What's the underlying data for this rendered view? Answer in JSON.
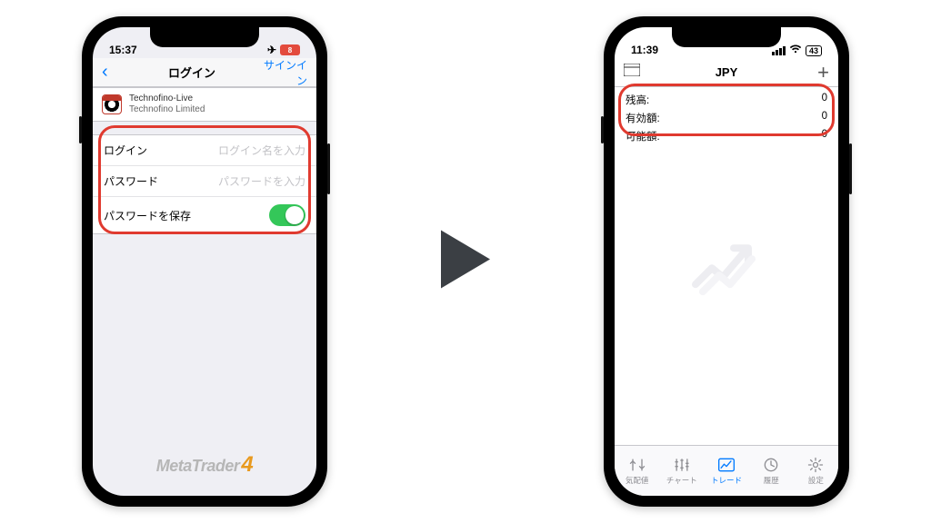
{
  "left": {
    "status_time": "15:37",
    "status_battery_low_badge": "8",
    "nav_title": "ログイン",
    "nav_signin": "サインイン",
    "account": {
      "name": "Technofino-Live",
      "company": "Technofino Limited"
    },
    "form": {
      "login_label": "ログイン",
      "login_placeholder": "ログイン名を入力",
      "password_label": "パスワード",
      "password_placeholder": "パスワードを入力",
      "save_password_label": "パスワードを保存",
      "save_password_on": true
    },
    "logo_text": "MetaTrader",
    "logo_num": "4"
  },
  "right": {
    "status_time": "11:39",
    "status_battery_pct": "43",
    "nav_title": "JPY",
    "summary": {
      "balance_label": "残高:",
      "balance_value": "0",
      "equity_label": "有効額:",
      "equity_value": "0",
      "free_margin_label": "可能額:",
      "free_margin_value": "0"
    },
    "tabs": {
      "quotes": "気配値",
      "chart": "チャート",
      "trade": "トレード",
      "history": "履歴",
      "settings": "設定"
    }
  }
}
